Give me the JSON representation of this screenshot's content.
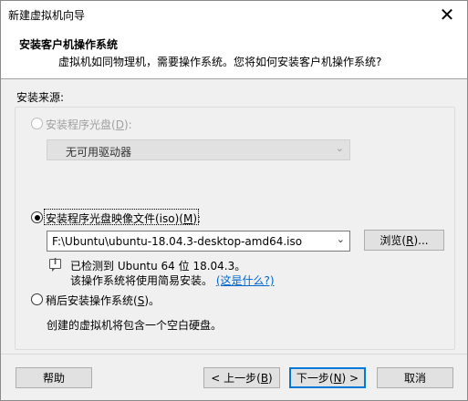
{
  "window": {
    "title": "新建虚拟机向导",
    "close_glyph": "✕"
  },
  "header": {
    "title": "安装客户机操作系统",
    "subtitle": "虚拟机如同物理机，需要操作系统。您将如何安装客户机操作系统?"
  },
  "source": {
    "label": "安装来源:",
    "disc": {
      "label_prefix": "安装程序光盘(",
      "label_key": "D",
      "label_suffix": "):",
      "selected": false,
      "enabled": false,
      "drive_value": "无可用驱动器"
    },
    "iso": {
      "label_prefix": "安装程序光盘映像文件(iso)(",
      "label_key": "M",
      "label_suffix": "):",
      "selected": true,
      "path_value": "F:\\Ubuntu\\ubuntu-18.04.3-desktop-amd64.iso",
      "browse_prefix": "浏览(",
      "browse_key": "R",
      "browse_suffix": ")...",
      "detected_line": "已检测到 Ubuntu 64 位 18.04.3。",
      "easy_install_line": "该操作系统将使用简易安装。",
      "whats_this": "(这是什么?)"
    },
    "later": {
      "label_prefix": "稍后安装操作系统(",
      "label_key": "S",
      "label_suffix": ")。",
      "selected": false,
      "description": "创建的虚拟机将包含一个空白硬盘。"
    }
  },
  "footer": {
    "help": "帮助",
    "back_prefix": "< 上一步(",
    "back_key": "B",
    "back_suffix": ")",
    "next_prefix": "下一步(",
    "next_key": "N",
    "next_suffix": ") >",
    "cancel": "取消"
  },
  "colors": {
    "accent": "#0078d7",
    "link": "#0066cc",
    "disabled_text": "#a0a0a0",
    "dialog_bg": "#f0f0f0"
  },
  "icons": {
    "info": "info-bubble-icon",
    "dropdown": "chevron-down-icon",
    "close": "close-icon"
  }
}
